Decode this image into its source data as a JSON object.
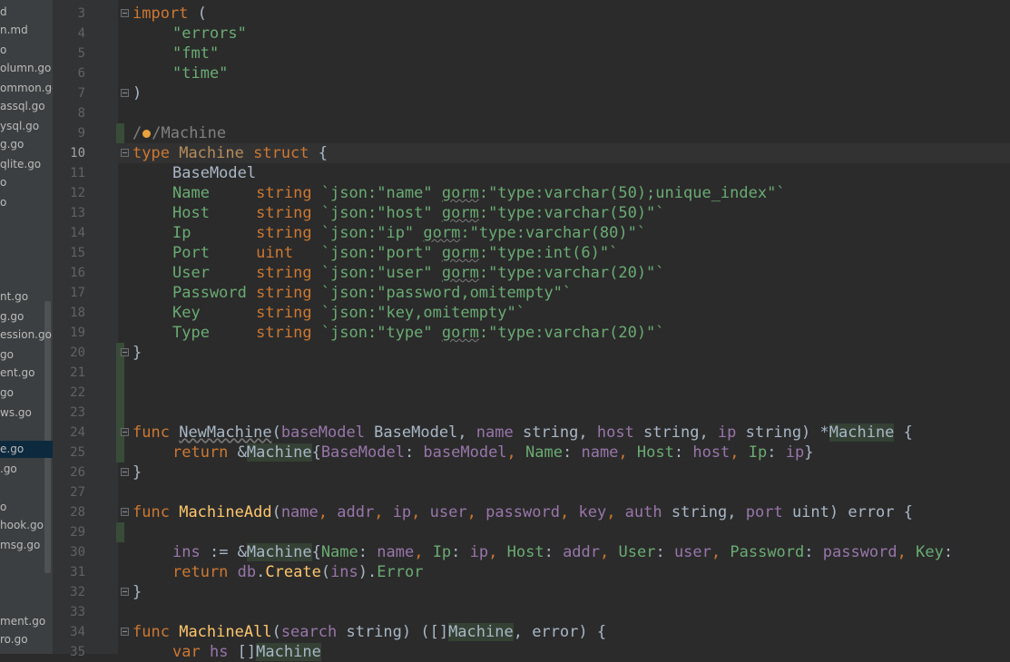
{
  "tree_items": [
    {
      "label": "d"
    },
    {
      "label": "n.md"
    },
    {
      "label": "o"
    },
    {
      "label": "olumn.go"
    },
    {
      "label": "ommon.go"
    },
    {
      "label": "assql.go"
    },
    {
      "label": "ysql.go"
    },
    {
      "label": "g.go"
    },
    {
      "label": "qlite.go"
    },
    {
      "label": "o"
    },
    {
      "label": "o"
    },
    {
      "label": "nt.go"
    },
    {
      "label": "g.go"
    },
    {
      "label": "ession.go"
    },
    {
      "label": "go"
    },
    {
      "label": "ent.go"
    },
    {
      "label": "go"
    },
    {
      "label": "ws.go"
    },
    {
      "label": "e.go",
      "selected": true
    },
    {
      "label": ".go"
    },
    {
      "label": "o"
    },
    {
      "label": "hook.go"
    },
    {
      "label": "msg.go"
    },
    {
      "label": "ment.go"
    },
    {
      "label": "ro.go"
    }
  ],
  "line_numbers": [
    "3",
    "4",
    "5",
    "6",
    "7",
    "8",
    "9",
    "10",
    "11",
    "12",
    "13",
    "14",
    "15",
    "16",
    "17",
    "18",
    "19",
    "20",
    "21",
    "22",
    "23",
    "24",
    "25",
    "26",
    "27",
    "28",
    "29",
    "30",
    "31",
    "32",
    "33",
    "34",
    "35"
  ],
  "current_line": "10",
  "code": {
    "l3_kw": "import",
    "l3_rest": " (",
    "l4": "\"errors\"",
    "l5": "\"fmt\"",
    "l6": "\"time\"",
    "l7": ")",
    "l9_a": "/",
    "l9_b": "/Machine",
    "l10_kw": "type",
    "l10_name": "Machine",
    "l10_kw2": "struct",
    "l10_brace": "{",
    "l11": "BaseModel",
    "fields": [
      {
        "name": "Name",
        "pad": "     ",
        "type": "string",
        "tag_a": "`json:\"name\" ",
        "gorm": "gorm",
        "tag_b": ":\"type:varchar(50);unique_index\"`"
      },
      {
        "name": "Host",
        "pad": "     ",
        "type": "string",
        "tag_a": "`json:\"host\" ",
        "gorm": "gorm",
        "tag_b": ":\"type:varchar(50)\"`"
      },
      {
        "name": "Ip",
        "pad": "       ",
        "type": "string",
        "tag_a": "`json:\"ip\" ",
        "gorm": "gorm",
        "tag_b": ":\"type:varchar(80)\"`"
      },
      {
        "name": "Port",
        "pad": "     ",
        "type": "uint  ",
        "tag_a": "`json:\"port\" ",
        "gorm": "gorm",
        "tag_b": ":\"type:int(6)\"`"
      },
      {
        "name": "User",
        "pad": "     ",
        "type": "string",
        "tag_a": "`json:\"user\" ",
        "gorm": "gorm",
        "tag_b": ":\"type:varchar(20)\"`"
      },
      {
        "name": "Password",
        "pad": " ",
        "type": "string",
        "tag_a": "`json:\"password,omitempty\"`",
        "gorm": "",
        "tag_b": ""
      },
      {
        "name": "Key",
        "pad": "      ",
        "type": "string",
        "tag_a": "`json:\"key,omitempty\"`",
        "gorm": "",
        "tag_b": ""
      },
      {
        "name": "Type",
        "pad": "     ",
        "type": "string",
        "tag_a": "`json:\"type\" ",
        "gorm": "gorm",
        "tag_b": ":\"type:varchar(20)\"`"
      }
    ],
    "l20": "}",
    "l24_kw": "func",
    "l24_fn": "NewMachine",
    "l24_p1": "(",
    "l24_a1": "baseModel",
    "l24_t1": " BaseModel, ",
    "l24_a2": "name",
    "l24_t2": " string, ",
    "l24_a3": "host",
    "l24_t3": " string, ",
    "l24_a4": "ip",
    "l24_t4": " string) *",
    "l24_ret": "Machine",
    "l24_end": " {",
    "l25_kw": "return",
    "l25_amp": " &",
    "l25_type": "Machine",
    "l25_b": "{",
    "l25_f1": "BaseModel",
    "l25_v1": ": ",
    "l25_a1": "baseModel",
    "l25_c1": ", ",
    "l25_f2": "Name",
    "l25_v2": ": ",
    "l25_a2": "name",
    "l25_c2": ", ",
    "l25_f3": "Host",
    "l25_v3": ": ",
    "l25_a3": "host",
    "l25_c3": ", ",
    "l25_f4": "Ip",
    "l25_v4": ": ",
    "l25_a4": "ip",
    "l25_e": "}",
    "l26": "}",
    "l28_kw": "func",
    "l28_fn": "MachineAdd",
    "l28_p": "(",
    "l28_params": [
      {
        "n": "name",
        "s": ", "
      },
      {
        "n": "addr",
        "s": ", "
      },
      {
        "n": "ip",
        "s": ", "
      },
      {
        "n": "user",
        "s": ", "
      },
      {
        "n": "password",
        "s": ", "
      },
      {
        "n": "key",
        "s": ", "
      },
      {
        "n": "auth",
        "s": " string, "
      },
      {
        "n": "port",
        "s": " uint) error {"
      }
    ],
    "l30_a": "ins",
    "l30_op": " := &",
    "l30_type": "Machine",
    "l30_b": "{",
    "l30_pairs": [
      {
        "k": "Name",
        "v": "name",
        "s": ", "
      },
      {
        "k": "Ip",
        "v": "ip",
        "s": ", "
      },
      {
        "k": "Host",
        "v": "addr",
        "s": ", "
      },
      {
        "k": "User",
        "v": "user",
        "s": ", "
      },
      {
        "k": "Password",
        "v": "password",
        "s": ", "
      },
      {
        "k": "Key",
        "v": "",
        "s": ""
      }
    ],
    "l31_kw": "return",
    "l31_db": " db",
    "l31_dot": ".",
    "l31_fn": "Create",
    "l31_p": "(",
    "l31_a": "ins",
    "l31_c": ").",
    "l31_err": "Error",
    "l32": "}",
    "l34_kw": "func",
    "l34_fn": "MachineAll",
    "l34_p": "(",
    "l34_a": "search",
    "l34_r": " string) ([]",
    "l34_t": "Machine",
    "l34_e": ", error) {",
    "l35_kw": "var",
    "l35_a": " hs",
    "l35_r": " []",
    "l35_t": "Machine"
  }
}
